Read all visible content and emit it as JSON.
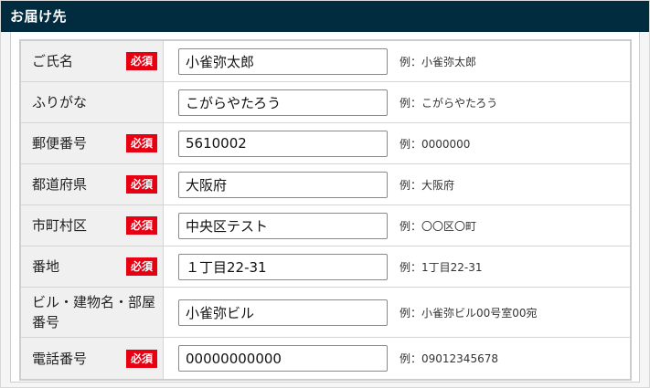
{
  "section": {
    "title": "お届け先"
  },
  "required_label": "必須",
  "rows": [
    {
      "label": "ご氏名",
      "required": true,
      "value": "小雀弥太郎",
      "example": "例：小雀弥太郎"
    },
    {
      "label": "ふりがな",
      "required": false,
      "value": "こがらやたろう",
      "example": "例：こがらやたろう"
    },
    {
      "label": "郵便番号",
      "required": true,
      "value": "5610002",
      "example": "例：0000000"
    },
    {
      "label": "都道府県",
      "required": true,
      "value": "大阪府",
      "example": "例：大阪府"
    },
    {
      "label": "市町村区",
      "required": true,
      "value": "中央区テスト",
      "example": "例：〇〇区〇町"
    },
    {
      "label": "番地",
      "required": true,
      "value": "１丁目22-31",
      "example": "例：1丁目22-31"
    },
    {
      "label": "ビル・建物名・部屋番号",
      "required": false,
      "value": "小雀弥ビル",
      "example": "例：小雀弥ビル00号室00宛"
    },
    {
      "label": "電話番号",
      "required": true,
      "value": "00000000000",
      "example": "例：09012345678"
    }
  ],
  "colors": {
    "header_bg": "#012b3f",
    "required_badge": "#e60012",
    "label_bg": "#f0f0f0"
  }
}
